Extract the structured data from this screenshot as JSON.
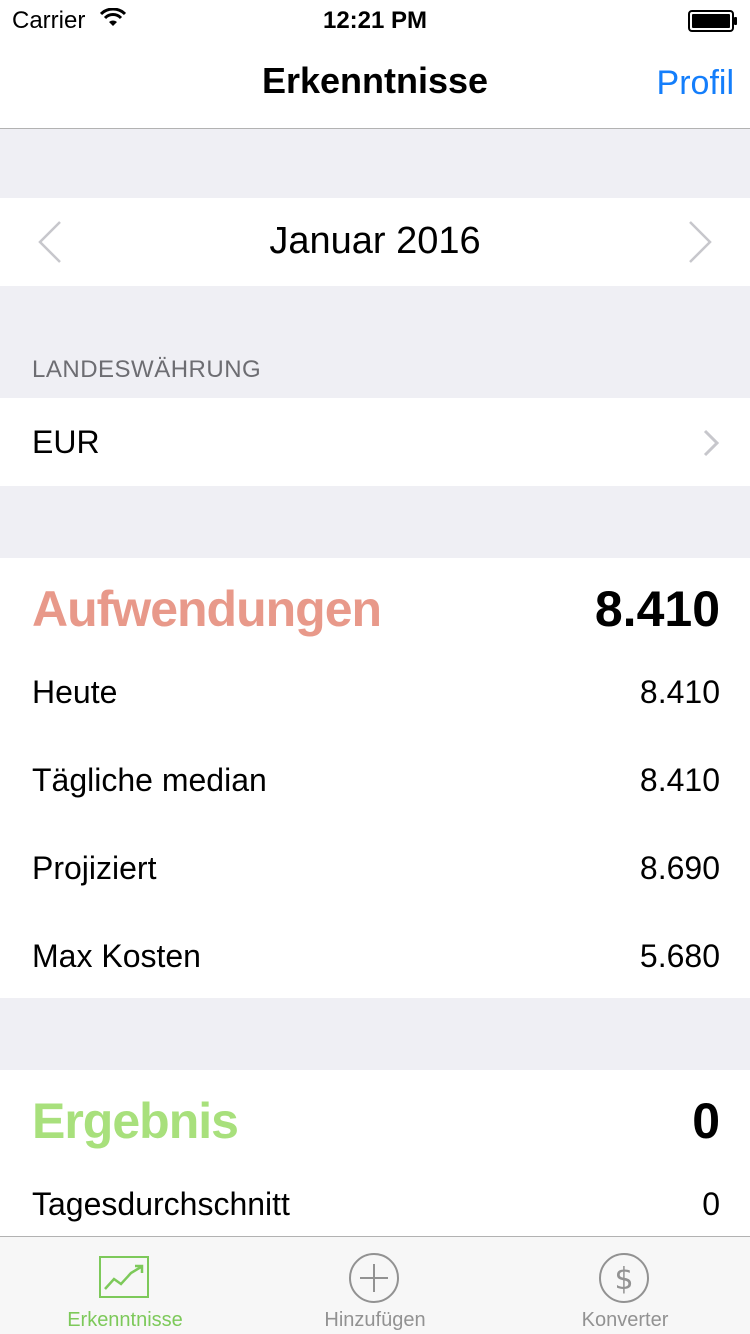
{
  "status_bar": {
    "carrier": "Carrier",
    "time": "12:21 PM"
  },
  "nav": {
    "title": "Erkenntnisse",
    "right_button": "Profil"
  },
  "month_selector": {
    "label": "Januar 2016"
  },
  "currency": {
    "section_header": "LANDESWÄHRUNG",
    "value": "EUR"
  },
  "expenses": {
    "title": "Aufwendungen",
    "total": "8.410",
    "rows": [
      {
        "label": "Heute",
        "value": "8.410"
      },
      {
        "label": "Tägliche median",
        "value": "8.410"
      },
      {
        "label": "Projiziert",
        "value": "8.690"
      },
      {
        "label": "Max Kosten",
        "value": "5.680"
      }
    ]
  },
  "income": {
    "title": "Ergebnis",
    "total": "0",
    "rows": [
      {
        "label": "Tagesdurchschnitt",
        "value": "0"
      }
    ]
  },
  "tabs": [
    {
      "label": "Erkenntnisse",
      "icon": "chart-icon",
      "active": true
    },
    {
      "label": "Hinzufügen",
      "icon": "add-circle-icon",
      "active": false
    },
    {
      "label": "Konverter",
      "icon": "dollar-circle-icon",
      "active": false
    }
  ],
  "colors": {
    "accent_blue": "#147efb",
    "expenses_red": "#e8998a",
    "income_green": "#a8e07c",
    "tab_active": "#7dc95a",
    "tab_inactive": "#929292"
  }
}
